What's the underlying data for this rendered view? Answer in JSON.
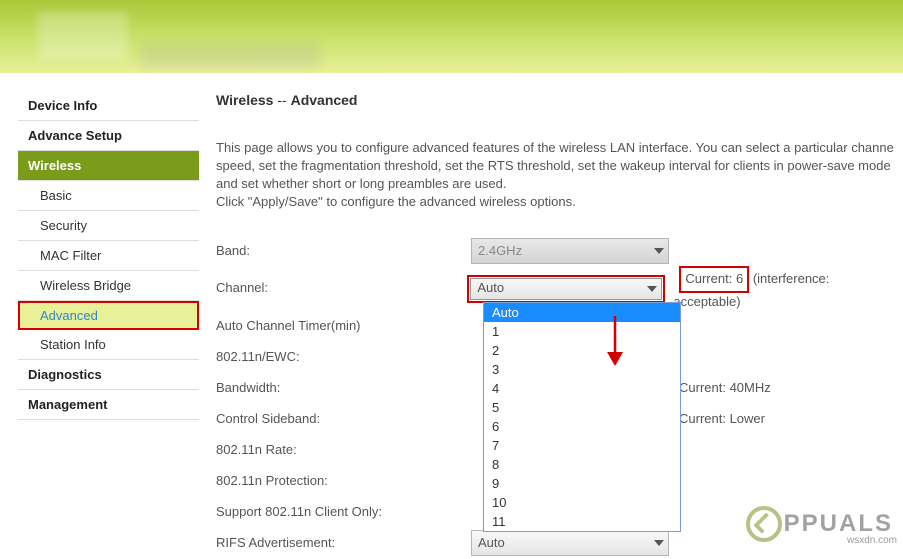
{
  "sidebar": {
    "items": [
      {
        "label": "Device Info",
        "type": "top"
      },
      {
        "label": "Advance Setup",
        "type": "top"
      },
      {
        "label": "Wireless",
        "type": "active-section"
      },
      {
        "label": "Basic",
        "type": "sub"
      },
      {
        "label": "Security",
        "type": "sub"
      },
      {
        "label": "MAC Filter",
        "type": "sub"
      },
      {
        "label": "Wireless Bridge",
        "type": "sub"
      },
      {
        "label": "Advanced",
        "type": "active-sub"
      },
      {
        "label": "Station Info",
        "type": "sub"
      },
      {
        "label": "Diagnostics",
        "type": "top"
      },
      {
        "label": "Management",
        "type": "top"
      }
    ]
  },
  "page": {
    "title_prefix": "Wireless",
    "title_sep": " -- ",
    "title_page": "Advanced",
    "description_line1": "This page allows you to configure advanced features of the wireless LAN interface. You can select a particular channe",
    "description_line2": "speed, set the fragmentation threshold, set the RTS threshold, set the wakeup interval for clients in power-save mode",
    "description_line3": "and set whether short or long preambles are used.",
    "description_line4": "Click \"Apply/Save\" to configure the advanced wireless options."
  },
  "form": {
    "band_label": "Band:",
    "band_value": "2.4GHz",
    "channel_label": "Channel:",
    "channel_value": "Auto",
    "channel_current_label": "Current:",
    "channel_current_value": "6",
    "channel_interference": "(interference: acceptable)",
    "auto_timer_label": "Auto Channel Timer(min)",
    "ewc_label": "802.11n/EWC:",
    "bandwidth_label": "Bandwidth:",
    "bandwidth_current": "Current: 40MHz",
    "sideband_label": "Control Sideband:",
    "sideband_current": "Current: Lower",
    "rate_label": "802.11n Rate:",
    "protection_label": "802.11n Protection:",
    "client_only_label": "Support 802.11n Client Only:",
    "rifs_label": "RIFS Advertisement:",
    "rifs_value": "Auto"
  },
  "dropdown": {
    "items": [
      "Auto",
      "1",
      "2",
      "3",
      "4",
      "5",
      "6",
      "7",
      "8",
      "9",
      "10",
      "11"
    ],
    "selected": "Auto"
  },
  "watermark": {
    "text": "PPUALS",
    "url": "wsxdn.com"
  }
}
